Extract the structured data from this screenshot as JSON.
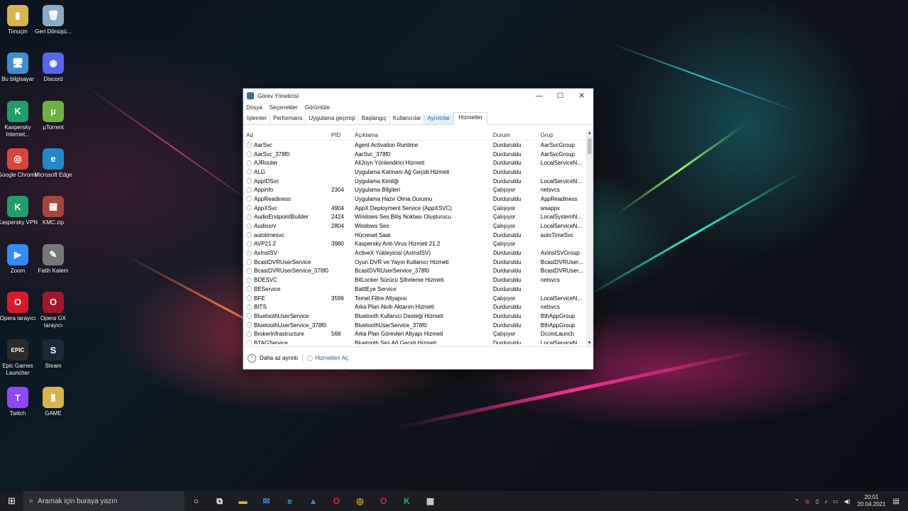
{
  "desktop": {
    "icons": [
      {
        "label": "Timuçin",
        "glyph": "▮",
        "color": "#d9b44a"
      },
      {
        "label": "Geri Dönüşü...",
        "glyph": "🗑",
        "color": "#8aa9c6"
      },
      {
        "label": "Bu bilgisayar",
        "glyph": "🖥",
        "color": "#3d8fd6"
      },
      {
        "label": "Discord",
        "glyph": "◉",
        "color": "#5865f2"
      },
      {
        "label": "Kaspersky Internet...",
        "glyph": "K",
        "color": "#1f9d6a"
      },
      {
        "label": "µTorrent",
        "glyph": "µ",
        "color": "#6cb33f"
      },
      {
        "label": "Google Chrome",
        "glyph": "◎",
        "color": "#db4437"
      },
      {
        "label": "Microsoft Edge",
        "glyph": "e",
        "color": "#1e88c8"
      },
      {
        "label": "Kaspersky VPN",
        "glyph": "K",
        "color": "#1f9d6a"
      },
      {
        "label": "KMC.zip",
        "glyph": "▦",
        "color": "#a8443c"
      },
      {
        "label": "Zoom",
        "glyph": "▶",
        "color": "#2d8cff"
      },
      {
        "label": "Fatih Kalem",
        "glyph": "✎",
        "color": "#777777"
      },
      {
        "label": "Opera tarayıcı",
        "glyph": "O",
        "color": "#d81b2a"
      },
      {
        "label": "Opera GX tarayıcı",
        "glyph": "O",
        "color": "#a3152a"
      },
      {
        "label": "Epic Games Launcher",
        "glyph": "EPIC",
        "color": "#2b2b2b"
      },
      {
        "label": "Steam",
        "glyph": "S",
        "color": "#1b2838"
      },
      {
        "label": "Twitch",
        "glyph": "T",
        "color": "#9146ff"
      },
      {
        "label": "GAME",
        "glyph": "▮",
        "color": "#d9b44a"
      }
    ]
  },
  "window": {
    "title": "Görev Yöneticisi",
    "controls": {
      "minimize": "—",
      "maximize": "☐",
      "close": "✕"
    },
    "menu": [
      "Dosya",
      "Seçenekler",
      "Görüntüle"
    ],
    "tabs": [
      "İşlemler",
      "Performans",
      "Uygulama geçmişi",
      "Başlangıç",
      "Kullanıcılar",
      "Ayrıntılar",
      "Hizmetler"
    ],
    "active_tab": "Hizmetler",
    "columns": {
      "name": "Ad",
      "pid": "PID",
      "desc": "Açıklama",
      "status": "Durum",
      "group": "Grup"
    },
    "services": [
      {
        "name": "AarSvc",
        "pid": "",
        "desc": "Agent Activation Runtime",
        "status": "Durduruldu",
        "group": "AarSvcGroup"
      },
      {
        "name": "AarSvc_378f0",
        "pid": "",
        "desc": "AarSvc_378f0",
        "status": "Durduruldu",
        "group": "AarSvcGroup"
      },
      {
        "name": "AJRouter",
        "pid": "",
        "desc": "AllJoyn Yönlendirici Hizmeti",
        "status": "Durduruldu",
        "group": "LocalServiceN..."
      },
      {
        "name": "ALG",
        "pid": "",
        "desc": "Uygulama Katmanı Ağ Geçidi Hizmeti",
        "status": "Durduruldu",
        "group": ""
      },
      {
        "name": "AppIDSvc",
        "pid": "",
        "desc": "Uygulama Kimliği",
        "status": "Durduruldu",
        "group": "LocalServiceN..."
      },
      {
        "name": "Appinfo",
        "pid": "2304",
        "desc": "Uygulama Bilgileri",
        "status": "Çalışıyor",
        "group": "netsvcs"
      },
      {
        "name": "AppReadiness",
        "pid": "",
        "desc": "Uygulama Hazır Olma Durumu",
        "status": "Durduruldu",
        "group": "AppReadiness"
      },
      {
        "name": "AppXSvc",
        "pid": "4904",
        "desc": "AppX Deployment Service (AppXSVC)",
        "status": "Çalışıyor",
        "group": "wsappx"
      },
      {
        "name": "AudioEndpointBuilder",
        "pid": "2424",
        "desc": "Windows Ses Bitiş Noktası Oluşturucu",
        "status": "Çalışıyor",
        "group": "LocalSystemN..."
      },
      {
        "name": "Audiosrv",
        "pid": "2804",
        "desc": "Windows Ses",
        "status": "Çalışıyor",
        "group": "LocalServiceN..."
      },
      {
        "name": "autotimesvc",
        "pid": "",
        "desc": "Hücresel Saat",
        "status": "Durduruldu",
        "group": "autoTimeSvc"
      },
      {
        "name": "AVP21.2",
        "pid": "3980",
        "desc": "Kaspersky Anti-Virus Hizmeti 21.2",
        "status": "Çalışıyor",
        "group": ""
      },
      {
        "name": "AxInstSV",
        "pid": "",
        "desc": "ActiveX Yükleyicisi (AxInstSV)",
        "status": "Durduruldu",
        "group": "AxInstSVGroup"
      },
      {
        "name": "BcastDVRUserService",
        "pid": "",
        "desc": "Oyun DVR ve Yayın Kullanıcı Hizmeti",
        "status": "Durduruldu",
        "group": "BcastDVRUser..."
      },
      {
        "name": "BcastDVRUserService_378f0",
        "pid": "",
        "desc": "BcastDVRUserService_378f0",
        "status": "Durduruldu",
        "group": "BcastDVRUser..."
      },
      {
        "name": "BDESVC",
        "pid": "",
        "desc": "BitLocker Sürücü Şifreleme Hizmeti",
        "status": "Durduruldu",
        "group": "netsvcs"
      },
      {
        "name": "BEService",
        "pid": "",
        "desc": "BattlEye Service",
        "status": "Durduruldu",
        "group": ""
      },
      {
        "name": "BFE",
        "pid": "3596",
        "desc": "Temel Filtre Altyapısı",
        "status": "Çalışıyor",
        "group": "LocalServiceN..."
      },
      {
        "name": "BITS",
        "pid": "",
        "desc": "Arka Plan Akıllı Aktarım Hizmeti",
        "status": "Durduruldu",
        "group": "netsvcs"
      },
      {
        "name": "BluetoothUserService",
        "pid": "",
        "desc": "Bluetooth Kullanıcı Desteği Hizmeti",
        "status": "Durduruldu",
        "group": "BthAppGroup"
      },
      {
        "name": "BluetoothUserService_378f0",
        "pid": "",
        "desc": "BluetoothUserService_378f0",
        "status": "Durduruldu",
        "group": "BthAppGroup"
      },
      {
        "name": "BrokerInfrastructure",
        "pid": "568",
        "desc": "Arka Plan Görevleri Altyapı Hizmeti",
        "status": "Çalışıyor",
        "group": "DcomLaunch"
      },
      {
        "name": "BTAGService",
        "pid": "",
        "desc": "Bluetooth Ses Ağ Geçidi Hizmeti",
        "status": "Durduruldu",
        "group": "LocalServiceN..."
      }
    ],
    "footer": {
      "less_details": "Daha az ayrıntı",
      "open_services": "Hizmetleri Aç"
    }
  },
  "taskbar": {
    "search_placeholder": "Aramak için buraya yazın",
    "apps": [
      {
        "name": "cortana-icon",
        "glyph": "○",
        "color": "#ffffff"
      },
      {
        "name": "task-view-icon",
        "glyph": "⧉",
        "color": "#ffffff"
      },
      {
        "name": "file-explorer-icon",
        "glyph": "▬",
        "color": "#e8b93a"
      },
      {
        "name": "mail-icon",
        "glyph": "✉",
        "color": "#3b8ee0"
      },
      {
        "name": "edge-icon",
        "glyph": "e",
        "color": "#2a9ee0"
      },
      {
        "name": "photos-icon",
        "glyph": "▲",
        "color": "#2f86d0"
      },
      {
        "name": "opera-gx-icon",
        "glyph": "O",
        "color": "#e0203a"
      },
      {
        "name": "chrome-icon",
        "glyph": "◎",
        "color": "#e4b82e"
      },
      {
        "name": "opera-icon",
        "glyph": "O",
        "color": "#e0203a"
      },
      {
        "name": "kaspersky-icon",
        "glyph": "K",
        "color": "#2eb37a"
      },
      {
        "name": "task-manager-icon",
        "glyph": "▦",
        "color": "#cfd6dd"
      }
    ],
    "time": "20:01",
    "date": "20.04.2021"
  }
}
